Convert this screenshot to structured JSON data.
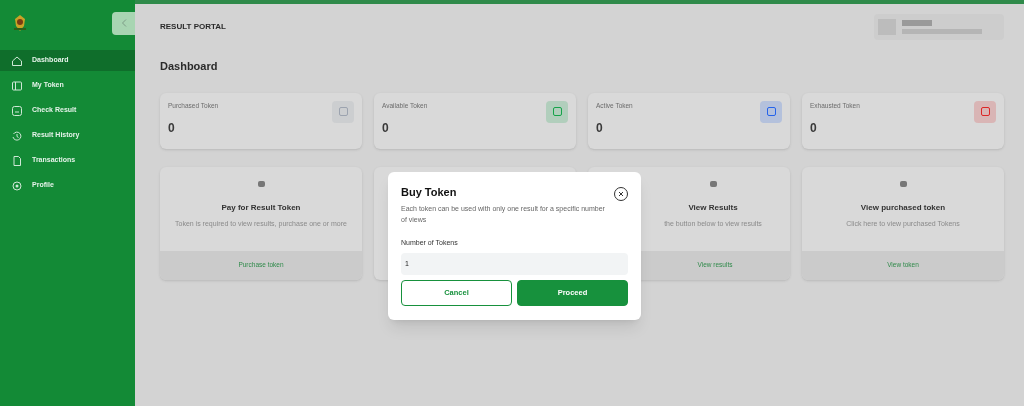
{
  "sidebar": {
    "items": [
      {
        "label": "Dashboard",
        "selected": true
      },
      {
        "label": "My Token",
        "selected": false
      },
      {
        "label": "Check Result",
        "selected": false
      },
      {
        "label": "Result History",
        "selected": false
      },
      {
        "label": "Transactions",
        "selected": false
      },
      {
        "label": "Profile",
        "selected": false
      }
    ]
  },
  "header": {
    "title": "RESULT PORTAL"
  },
  "page_title": "Dashboard",
  "stats": [
    {
      "label": "Purchased Token",
      "value": "0",
      "color": "#9ca3af"
    },
    {
      "label": "Available Token",
      "value": "0",
      "color": "#16a34a"
    },
    {
      "label": "Active Token",
      "value": "0",
      "color": "#2563eb"
    },
    {
      "label": "Exhausted Token",
      "value": "0",
      "color": "#dc2626"
    }
  ],
  "action_cards": [
    {
      "title": "Pay for Result Token",
      "description": "Token is required to view results, purchase one or more",
      "action": "Purchase token"
    },
    {
      "title": "View Results",
      "description": "the button below to view results",
      "action": "View results"
    },
    {
      "title": "View purchased token",
      "description": "Click here to view purchased Tokens",
      "action": "View token"
    }
  ],
  "modal": {
    "title": "Buy Token",
    "description": "Each token can be used with only one result for a specific number of views",
    "field_label": "Number of Tokens",
    "field_value": "1",
    "buttons": [
      {
        "label": "Cancel",
        "kind": "secondary"
      },
      {
        "label": "Proceed",
        "kind": "primary"
      }
    ]
  }
}
